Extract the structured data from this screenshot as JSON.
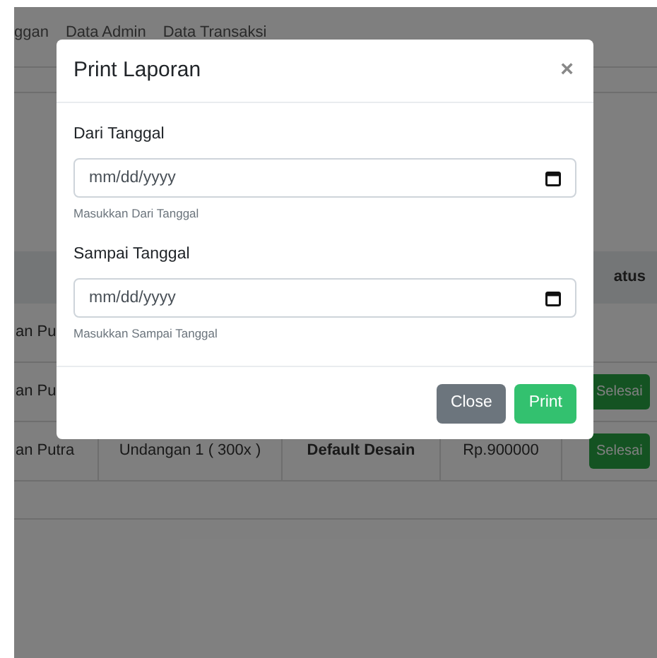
{
  "background": {
    "nav": [
      "ggan",
      "Data Admin",
      "Data Transaksi"
    ],
    "table": {
      "header_status": "atus",
      "rows": [
        {
          "column_1": "an Pu",
          "status": null
        },
        {
          "column_1": "an Pu",
          "status": "Selesai"
        },
        {
          "column_1": "an Putra",
          "column_2": "Undangan 1 ( 300x )",
          "column_3": "Default Desain",
          "column_4": "Rp.900000",
          "status": "Selesai"
        }
      ]
    }
  },
  "modal": {
    "title": "Print Laporan",
    "close_icon": "×",
    "fields": [
      {
        "label": "Dari Tanggal",
        "placeholder": "mm/dd/yyyy",
        "hint": "Masukkan Dari Tanggal"
      },
      {
        "label": "Sampai Tanggal",
        "placeholder": "mm/dd/yyyy",
        "hint": "Masukkan Sampai Tanggal"
      }
    ],
    "buttons": [
      {
        "label": "Close",
        "kind": "secondary"
      },
      {
        "label": "Print",
        "kind": "primary"
      }
    ]
  }
}
